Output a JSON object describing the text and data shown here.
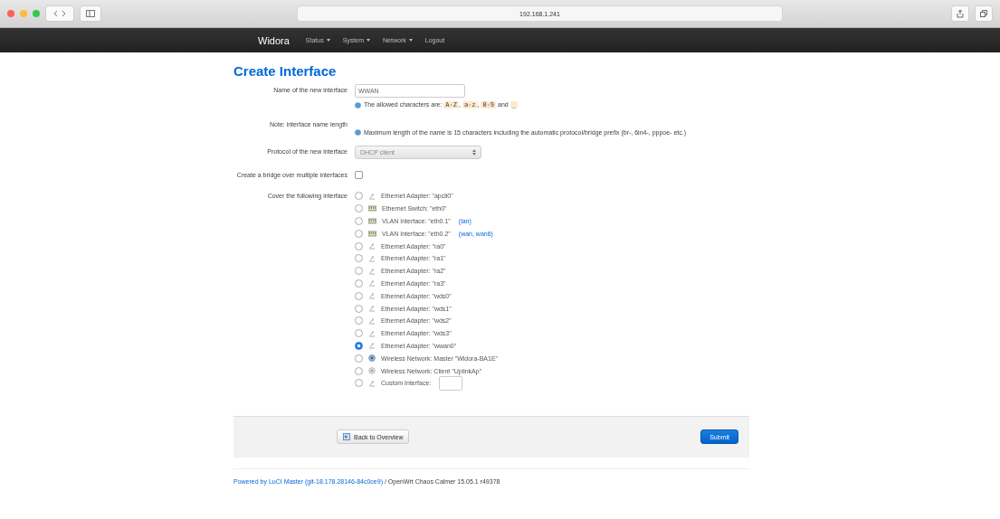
{
  "browser": {
    "address": "192.168.1.241"
  },
  "navbar": {
    "brand": "Widora",
    "items": [
      {
        "label": "Status",
        "dropdown": true
      },
      {
        "label": "System",
        "dropdown": true
      },
      {
        "label": "Network",
        "dropdown": true
      },
      {
        "label": "Logout",
        "dropdown": false
      }
    ]
  },
  "title": "Create Interface",
  "fields": [
    {
      "kind": "text",
      "label": "Name of the new interface",
      "value": "WWAN",
      "hint": [
        {
          "text": "The allowed characters are: ",
          "code": false
        },
        {
          "text": "A-Z",
          "code": true
        },
        {
          "text": ", ",
          "code": false
        },
        {
          "text": "a-z",
          "code": true
        },
        {
          "text": ", ",
          "code": false
        },
        {
          "text": "0-9",
          "code": true
        },
        {
          "text": " and ",
          "code": false
        },
        {
          "text": "_",
          "code": true
        }
      ]
    },
    {
      "kind": "note",
      "label": "Note: interface name length",
      "hint": [
        {
          "text": "Maximum length of the name is 15 characters including the automatic protocol/bridge prefix (br-, 6in4-, pppoe- etc.)",
          "code": false
        }
      ]
    },
    {
      "kind": "select",
      "label": "Protocol of the new interface",
      "value": "DHCP client"
    },
    {
      "kind": "checkbox",
      "label": "Create a bridge over multiple interfaces",
      "checked": false
    },
    {
      "kind": "radios",
      "label": "Cover the following interface",
      "options": [
        {
          "kind": "adapter",
          "label": "Ethernet Adapter: \"apcli0\"",
          "selected": false
        },
        {
          "kind": "switch",
          "label": "Ethernet Switch: \"eth0\"",
          "selected": false
        },
        {
          "kind": "switch",
          "label": "VLAN Interface: \"eth0.1\"",
          "link": "(lan)",
          "selected": false
        },
        {
          "kind": "switch",
          "label": "VLAN Interface: \"eth0.2\"",
          "link": "(wan, wan6)",
          "selected": false
        },
        {
          "kind": "adapter",
          "label": "Ethernet Adapter: \"ra0\"",
          "selected": false
        },
        {
          "kind": "adapter",
          "label": "Ethernet Adapter: \"ra1\"",
          "selected": false
        },
        {
          "kind": "adapter",
          "label": "Ethernet Adapter: \"ra2\"",
          "selected": false
        },
        {
          "kind": "adapter",
          "label": "Ethernet Adapter: \"ra3\"",
          "selected": false
        },
        {
          "kind": "adapter",
          "label": "Ethernet Adapter: \"wds0\"",
          "selected": false
        },
        {
          "kind": "adapter",
          "label": "Ethernet Adapter: \"wds1\"",
          "selected": false
        },
        {
          "kind": "adapter",
          "label": "Ethernet Adapter: \"wds2\"",
          "selected": false
        },
        {
          "kind": "adapter",
          "label": "Ethernet Adapter: \"wds3\"",
          "selected": false
        },
        {
          "kind": "adapter",
          "label": "Ethernet Adapter: \"wwan0\"",
          "selected": true
        },
        {
          "kind": "wireless",
          "label": "Wireless Network: Master \"Widora-BA1E\"",
          "selected": false
        },
        {
          "kind": "wireless-client",
          "label": "Wireless Network: Client \"UplinkAp\"",
          "selected": false
        },
        {
          "kind": "custom",
          "label": "Custom Interface:",
          "selected": false
        }
      ]
    }
  ],
  "actions": {
    "back": "Back to Overview",
    "submit": "Submit"
  },
  "footer": {
    "link": "Powered by LuCI Master (git-18.178.28146-84c0ce9)",
    "text": " / OpenWrt Chaos Calmer 15.05.1 r49378"
  }
}
